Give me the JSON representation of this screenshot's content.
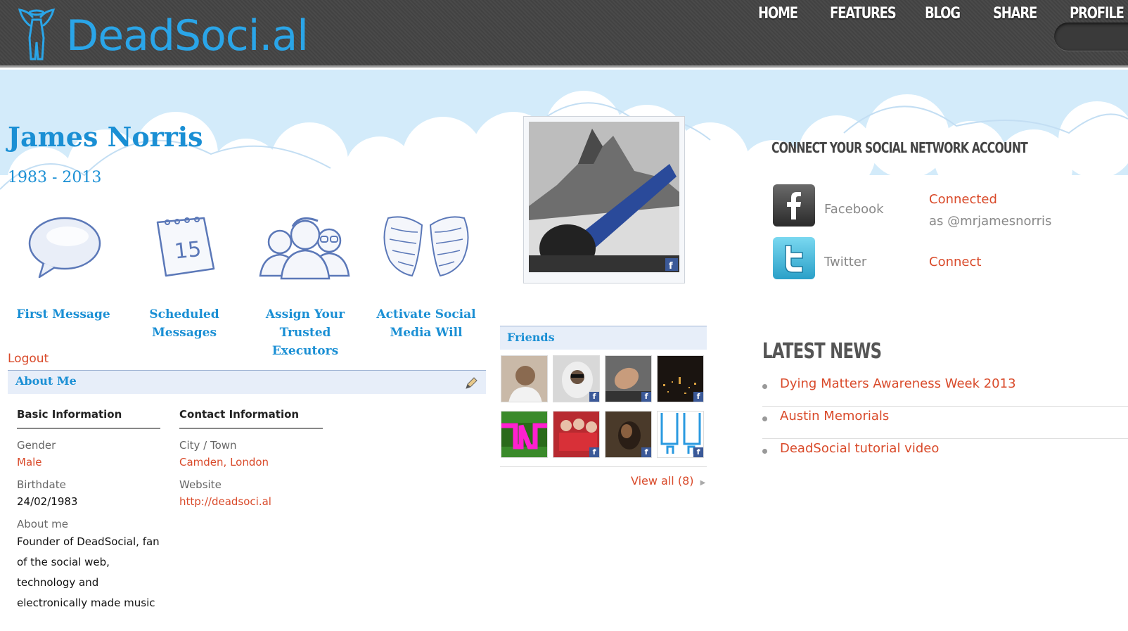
{
  "header": {
    "logo_text": "DeadSoci.al",
    "nav": [
      {
        "label": "HOME"
      },
      {
        "label": "FEATURES"
      },
      {
        "label": "BLOG"
      },
      {
        "label": "SHARE"
      },
      {
        "label": "PROFILE",
        "active": true
      }
    ]
  },
  "profile": {
    "name": "James Norris",
    "years": "1983 - 2013",
    "actions": [
      {
        "label": "First Message",
        "icon": "speech-bubble-icon"
      },
      {
        "label": "Scheduled Messages",
        "icon": "calendar-icon",
        "calendar_day": "15"
      },
      {
        "label": "Assign Your Trusted Executors",
        "icon": "people-icon"
      },
      {
        "label": "Activate Social Media Will",
        "icon": "angel-wings-icon"
      }
    ],
    "logout_label": "Logout"
  },
  "about": {
    "title": "About Me",
    "basic": {
      "title": "Basic Information",
      "gender_label": "Gender",
      "gender": "Male",
      "birthdate_label": "Birthdate",
      "birthdate": "24/02/1983",
      "about_label": "About me",
      "about": "Founder of DeadSocial, fan of the social web, technology and electronically made music"
    },
    "contact": {
      "title": "Contact Information",
      "city_label": "City / Town",
      "city": "Camden, London",
      "website_label": "Website",
      "website": "http://deadsoci.al"
    }
  },
  "friends": {
    "title": "Friends",
    "view_all": "View all (8)",
    "facebook_badge": "f"
  },
  "social": {
    "title": "CONNECT YOUR SOCIAL NETWORK ACCOUNT",
    "accounts": [
      {
        "name": "Facebook",
        "status": "Connected",
        "sub": "as @mrjamesnorris",
        "icon": "facebook-icon"
      },
      {
        "name": "Twitter",
        "status": "Connect",
        "sub": "",
        "icon": "twitter-icon"
      }
    ]
  },
  "news": {
    "title": "LATEST NEWS",
    "items": [
      {
        "title": "Dying Matters Awareness Week 2013"
      },
      {
        "title": "Austin Memorials"
      },
      {
        "title": "DeadSocial tutorial video"
      }
    ]
  },
  "colors": {
    "brand_blue": "#2aa5e8",
    "link_blue": "#1a8fd4",
    "accent_orange": "#d94a2a",
    "sky": "#d3ebfa",
    "facebook": "#3b5998"
  }
}
